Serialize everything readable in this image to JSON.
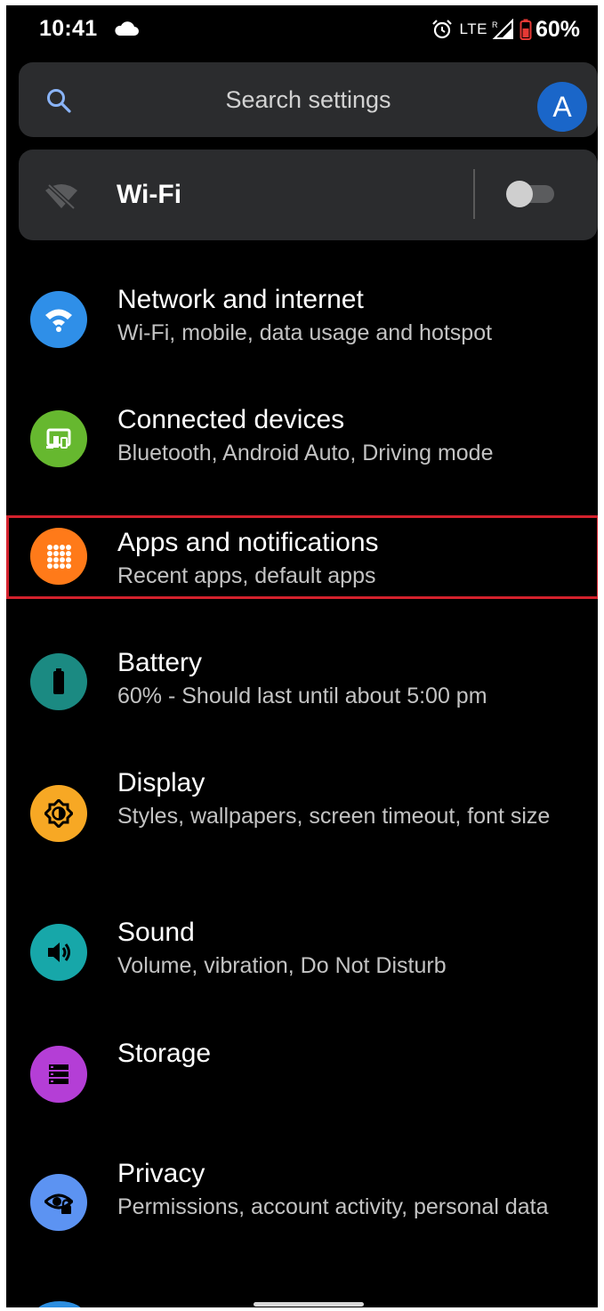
{
  "status_bar": {
    "time": "10:41",
    "network": "LTE",
    "roaming": "R",
    "battery_percent": "60%",
    "icons": [
      "cloud-icon",
      "alarm-icon",
      "signal-icon",
      "battery-icon"
    ]
  },
  "search": {
    "placeholder": "Search settings",
    "avatar_letter": "A",
    "avatar_color": "#1a66c9"
  },
  "wifi_tile": {
    "label": "Wi-Fi",
    "enabled": false
  },
  "settings": [
    {
      "title": "Network and internet",
      "subtitle": "Wi-Fi, mobile, data usage and hotspot",
      "icon": "wifi-icon",
      "color": "#2f8fe8"
    },
    {
      "title": "Connected devices",
      "subtitle": "Bluetooth, Android Auto, Driving mode",
      "icon": "devices-icon",
      "color": "#66b82f"
    },
    {
      "title": "Apps and notifications",
      "subtitle": "Recent apps, default apps",
      "icon": "apps-grid-icon",
      "color": "#ff7a19",
      "highlighted": true
    },
    {
      "title": "Battery",
      "subtitle": "60% - Should last until about 5:00 pm",
      "icon": "battery-icon",
      "color": "#1b8a82"
    },
    {
      "title": "Display",
      "subtitle": "Styles, wallpapers, screen timeout, font size",
      "icon": "brightness-icon",
      "color": "#f7a824"
    },
    {
      "title": "Sound",
      "subtitle": "Volume, vibration, Do Not Disturb",
      "icon": "volume-icon",
      "color": "#17a7a9"
    },
    {
      "title": "Storage",
      "subtitle": "",
      "icon": "storage-icon",
      "color": "#b43ed6"
    },
    {
      "title": "Privacy",
      "subtitle": "Permissions, account activity, personal data",
      "icon": "privacy-eye-icon",
      "color": "#5c93f2"
    }
  ],
  "highlight_color": "#d3212c"
}
